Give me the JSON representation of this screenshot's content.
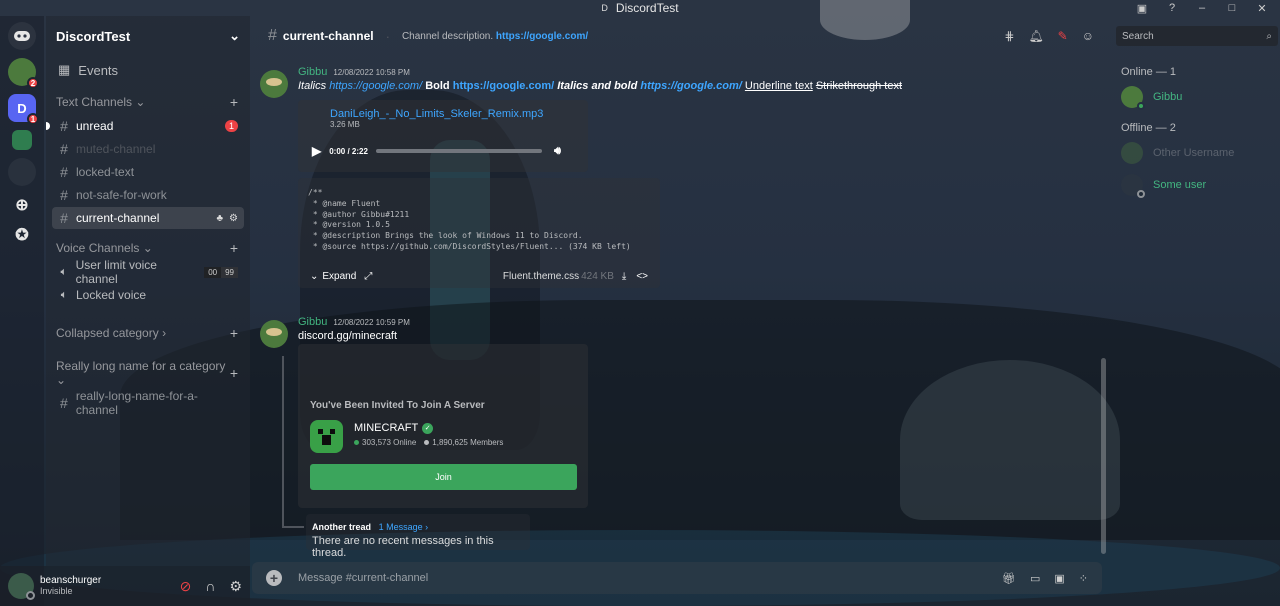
{
  "window": {
    "title": "DiscordTest",
    "logo_letter": "D"
  },
  "rail": {
    "pepe_badge": "2",
    "d_server_letter": "D",
    "d_badge": "1"
  },
  "sidebar": {
    "guild_name": "DiscordTest",
    "events_label": "Events",
    "text_category": "Text Channels",
    "voice_category": "Voice Channels",
    "collapsed_category": "Collapsed category",
    "long_category": "Really long name for a category",
    "channels": {
      "unread": "unread",
      "unread_mentions": "1",
      "muted": "muted-channel",
      "locked": "locked-text",
      "nsfw": "not-safe-for-work",
      "current": "current-channel",
      "long": "really-long-name-for-a-channel"
    },
    "voice": {
      "user_limit": "User limit voice channel",
      "limit_current": "00",
      "limit_max": "99",
      "locked": "Locked voice"
    }
  },
  "user_panel": {
    "username": "beanschurger",
    "status": "Invisible"
  },
  "header": {
    "channel_name": "current-channel",
    "description_prefix": "Channel description.",
    "description_link": "https://google.com/"
  },
  "search": {
    "placeholder": "Search"
  },
  "messages": [
    {
      "author": "Gibbu",
      "timestamp": "12/08/2022 10:58 PM",
      "parts": {
        "italics": "Italics",
        "link1": "https://google.com/",
        "bold": "Bold",
        "link2": "https://google.com/",
        "italics_bold": "Italics and bold",
        "link3": "https://google.com/",
        "underline": "Underline text",
        "strike": "Strikethrough text"
      },
      "audio": {
        "file_name": "DaniLeigh_-_No_Limits_Skeler_Remix.mp3",
        "file_size": "3.26 MB",
        "time": "0:00 / 2:22",
        "progress": 0
      },
      "code_file": {
        "lines": "/**\n * @name Fluent\n * @author Gibbu#1211\n * @version 1.0.5\n * @description Brings the look of Windows 11 to Discord.\n * @source https://github.com/DiscordStyles/Fluent... (374 KB left)",
        "expand_label": "Expand",
        "file_name": "Fluent.theme.css",
        "file_size": "424 KB"
      }
    },
    {
      "author": "Gibbu",
      "timestamp": "12/08/2022 10:59 PM",
      "text": "discord.gg/minecraft",
      "invite": {
        "title": "You've Been Invited To Join A Server",
        "server_name": "MINECRAFT",
        "online": "303,573 Online",
        "members": "1,890,625 Members",
        "join_label": "Join"
      },
      "thread": {
        "name": "Another tread",
        "count": "1 Message ›",
        "preview": "There are no recent messages in this thread."
      }
    }
  ],
  "composer": {
    "placeholder": "Message #current-channel"
  },
  "members": {
    "online_header": "Online — 1",
    "offline_header": "Offline — 2",
    "online": [
      {
        "name": "Gibbu"
      }
    ],
    "offline": [
      {
        "name": "Other Username"
      },
      {
        "name": "Some user"
      }
    ]
  },
  "colors": {
    "accent": "#5865f2",
    "link": "#3ea6ff",
    "online": "#43b581",
    "danger": "#ed4245",
    "join": "#3ba55c"
  }
}
